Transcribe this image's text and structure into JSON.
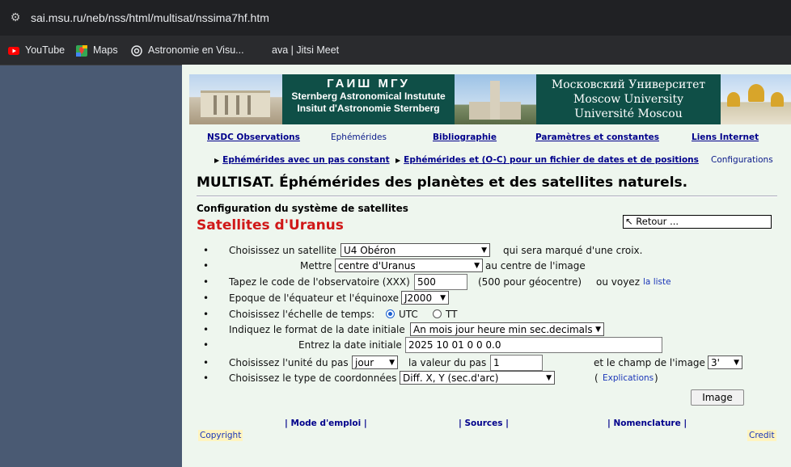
{
  "browser": {
    "url": "sai.msu.ru/neb/nss/html/multisat/nssima7hf.htm",
    "bookmarks": [
      "YouTube",
      "Maps",
      "Astronomie en Visu...",
      "ava | Jitsi Meet"
    ]
  },
  "banner": {
    "gaish": [
      "ГАИШ МГУ",
      "Sternberg Astronomical Instutute",
      "Insitut d'Astronomie Sternberg"
    ],
    "msu": [
      "Московский Университет",
      "Moscow University",
      "Université Moscou"
    ]
  },
  "nav": {
    "top": [
      "NSDC Observations",
      "Ephémérides",
      "Bibliographie",
      "Paramètres et constantes",
      "Liens Internet"
    ],
    "sub": [
      "Ephémérides avec un pas constant",
      "Ephémérides et (O-C) pour un fichier de dates et de positions"
    ],
    "config": "Configurations"
  },
  "title": "MULTISAT. Éphémérides des planètes et des satellites naturels.",
  "subtitle": "Configuration du système de satellites",
  "system": "Satellites d'Uranus",
  "retour": "Retour ...",
  "form": {
    "r1": {
      "label": "Choisissez un satellite",
      "value": "U4 Obéron",
      "after": "qui sera marqué d'une croix."
    },
    "r2": {
      "label": "Mettre",
      "value": "centre d'Uranus",
      "after": "au centre de l'image"
    },
    "r3": {
      "label": "Tapez le code de l'observatoire (XXX)",
      "value": "500",
      "note": "(500 pour géocentre)",
      "or": "ou voyez",
      "link": "la liste"
    },
    "r4": {
      "label": "Epoque de l'équateur et l'équinoxe",
      "value": "J2000"
    },
    "r5": {
      "label": "Choisissez l'échelle de temps:",
      "opt1": "UTC",
      "opt2": "TT"
    },
    "r6": {
      "label": "Indiquez le format de la date initiale",
      "value": "An mois jour heure min sec.decimals"
    },
    "r7": {
      "label": "Entrez la date initiale",
      "value": "2025 10 01 0 0 0.0"
    },
    "r8": {
      "label": "Choisissez l'unité du pas",
      "unit": "jour",
      "mid": "la valeur du pas",
      "step": "1",
      "field_label": "et le champ de l'image",
      "field": "3'"
    },
    "r9": {
      "label": "Choisissez le type de coordonnées",
      "value": "Diff. X, Y (sec.d'arc)",
      "paren_open": "(",
      "link": "Explications",
      "paren_close": ")"
    }
  },
  "image_button": "Image",
  "footer": {
    "links": [
      "| Mode d'emploi |",
      "| Sources |",
      "| Nomenclature |"
    ],
    "copyright": "Copyright",
    "credit": "Credit"
  }
}
